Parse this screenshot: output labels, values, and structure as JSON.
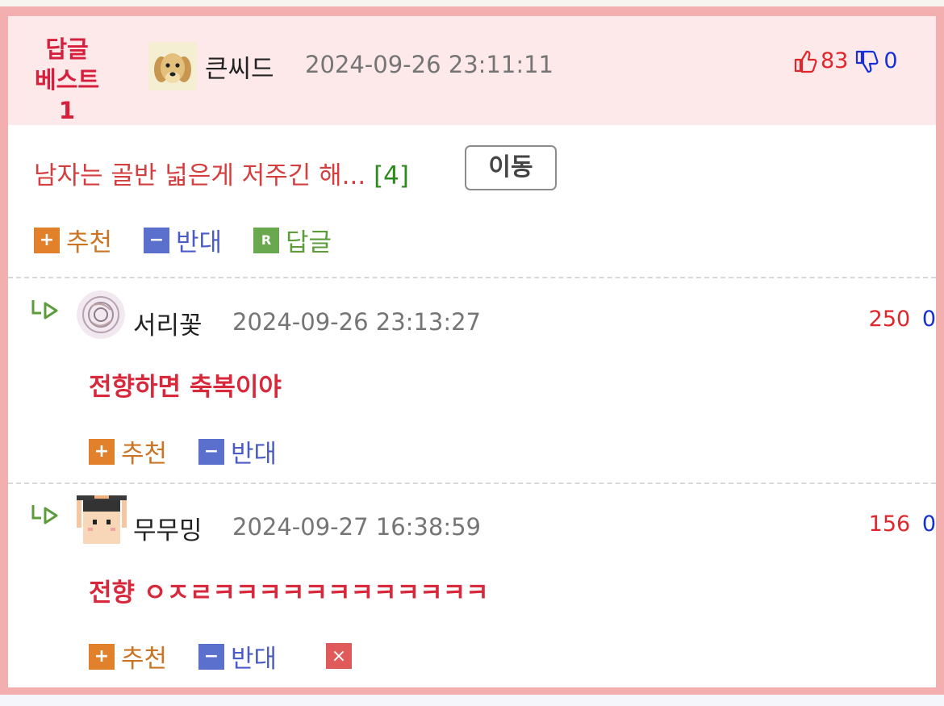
{
  "best": {
    "label_line1": "답글",
    "label_line2": "베스트1",
    "nickname": "큰씨드",
    "date": "2024-09-26 23:11:11",
    "likes": "83",
    "dislikes": "0",
    "title": "남자는 골반 넓은게 저주긴 해...",
    "reply_count": "[4]",
    "move_label": "이동",
    "recommend_label": "추천",
    "oppose_label": "반대",
    "reply_label": "답글"
  },
  "replies": [
    {
      "nickname": "서리꽃",
      "date": "2024-09-26 23:13:27",
      "likes": "250",
      "dislikes": "0",
      "text": "전향하면 축복이야",
      "recommend_label": "추천",
      "oppose_label": "반대"
    },
    {
      "nickname": "무무밍",
      "date": "2024-09-27 16:38:59",
      "likes": "156",
      "dislikes": "0",
      "text": "전향 ㅇㅈㄹㅋㅋㅋㅋㅋㅋㅋㅋㅋㅋㅋㅋ",
      "recommend_label": "추천",
      "oppose_label": "반대"
    }
  ],
  "icons": {
    "plus": "+",
    "minus": "−",
    "reply": "R",
    "delete": "×"
  },
  "colors": {
    "border": "#f3aeb0",
    "header_bg": "#fde9ea",
    "like": "#e0262a",
    "dislike": "#1530d8"
  }
}
